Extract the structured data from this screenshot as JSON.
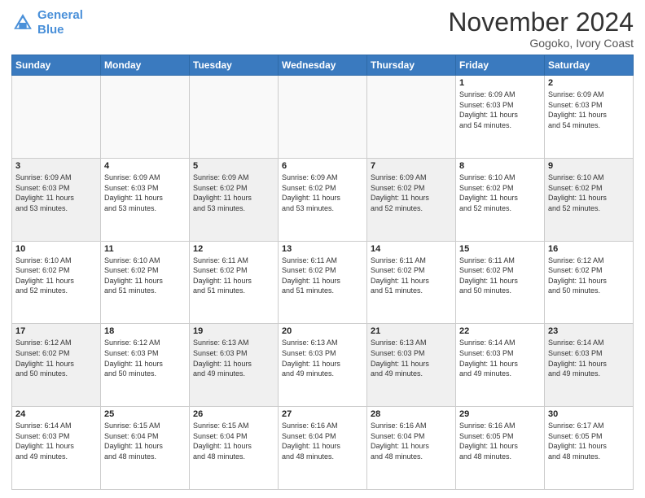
{
  "header": {
    "logo_line1": "General",
    "logo_line2": "Blue",
    "month": "November 2024",
    "location": "Gogoko, Ivory Coast"
  },
  "weekdays": [
    "Sunday",
    "Monday",
    "Tuesday",
    "Wednesday",
    "Thursday",
    "Friday",
    "Saturday"
  ],
  "weeks": [
    [
      {
        "day": "",
        "info": ""
      },
      {
        "day": "",
        "info": ""
      },
      {
        "day": "",
        "info": ""
      },
      {
        "day": "",
        "info": ""
      },
      {
        "day": "",
        "info": ""
      },
      {
        "day": "1",
        "info": "Sunrise: 6:09 AM\nSunset: 6:03 PM\nDaylight: 11 hours\nand 54 minutes."
      },
      {
        "day": "2",
        "info": "Sunrise: 6:09 AM\nSunset: 6:03 PM\nDaylight: 11 hours\nand 54 minutes."
      }
    ],
    [
      {
        "day": "3",
        "info": "Sunrise: 6:09 AM\nSunset: 6:03 PM\nDaylight: 11 hours\nand 53 minutes."
      },
      {
        "day": "4",
        "info": "Sunrise: 6:09 AM\nSunset: 6:03 PM\nDaylight: 11 hours\nand 53 minutes."
      },
      {
        "day": "5",
        "info": "Sunrise: 6:09 AM\nSunset: 6:02 PM\nDaylight: 11 hours\nand 53 minutes."
      },
      {
        "day": "6",
        "info": "Sunrise: 6:09 AM\nSunset: 6:02 PM\nDaylight: 11 hours\nand 53 minutes."
      },
      {
        "day": "7",
        "info": "Sunrise: 6:09 AM\nSunset: 6:02 PM\nDaylight: 11 hours\nand 52 minutes."
      },
      {
        "day": "8",
        "info": "Sunrise: 6:10 AM\nSunset: 6:02 PM\nDaylight: 11 hours\nand 52 minutes."
      },
      {
        "day": "9",
        "info": "Sunrise: 6:10 AM\nSunset: 6:02 PM\nDaylight: 11 hours\nand 52 minutes."
      }
    ],
    [
      {
        "day": "10",
        "info": "Sunrise: 6:10 AM\nSunset: 6:02 PM\nDaylight: 11 hours\nand 52 minutes."
      },
      {
        "day": "11",
        "info": "Sunrise: 6:10 AM\nSunset: 6:02 PM\nDaylight: 11 hours\nand 51 minutes."
      },
      {
        "day": "12",
        "info": "Sunrise: 6:11 AM\nSunset: 6:02 PM\nDaylight: 11 hours\nand 51 minutes."
      },
      {
        "day": "13",
        "info": "Sunrise: 6:11 AM\nSunset: 6:02 PM\nDaylight: 11 hours\nand 51 minutes."
      },
      {
        "day": "14",
        "info": "Sunrise: 6:11 AM\nSunset: 6:02 PM\nDaylight: 11 hours\nand 51 minutes."
      },
      {
        "day": "15",
        "info": "Sunrise: 6:11 AM\nSunset: 6:02 PM\nDaylight: 11 hours\nand 50 minutes."
      },
      {
        "day": "16",
        "info": "Sunrise: 6:12 AM\nSunset: 6:02 PM\nDaylight: 11 hours\nand 50 minutes."
      }
    ],
    [
      {
        "day": "17",
        "info": "Sunrise: 6:12 AM\nSunset: 6:02 PM\nDaylight: 11 hours\nand 50 minutes."
      },
      {
        "day": "18",
        "info": "Sunrise: 6:12 AM\nSunset: 6:03 PM\nDaylight: 11 hours\nand 50 minutes."
      },
      {
        "day": "19",
        "info": "Sunrise: 6:13 AM\nSunset: 6:03 PM\nDaylight: 11 hours\nand 49 minutes."
      },
      {
        "day": "20",
        "info": "Sunrise: 6:13 AM\nSunset: 6:03 PM\nDaylight: 11 hours\nand 49 minutes."
      },
      {
        "day": "21",
        "info": "Sunrise: 6:13 AM\nSunset: 6:03 PM\nDaylight: 11 hours\nand 49 minutes."
      },
      {
        "day": "22",
        "info": "Sunrise: 6:14 AM\nSunset: 6:03 PM\nDaylight: 11 hours\nand 49 minutes."
      },
      {
        "day": "23",
        "info": "Sunrise: 6:14 AM\nSunset: 6:03 PM\nDaylight: 11 hours\nand 49 minutes."
      }
    ],
    [
      {
        "day": "24",
        "info": "Sunrise: 6:14 AM\nSunset: 6:03 PM\nDaylight: 11 hours\nand 49 minutes."
      },
      {
        "day": "25",
        "info": "Sunrise: 6:15 AM\nSunset: 6:04 PM\nDaylight: 11 hours\nand 48 minutes."
      },
      {
        "day": "26",
        "info": "Sunrise: 6:15 AM\nSunset: 6:04 PM\nDaylight: 11 hours\nand 48 minutes."
      },
      {
        "day": "27",
        "info": "Sunrise: 6:16 AM\nSunset: 6:04 PM\nDaylight: 11 hours\nand 48 minutes."
      },
      {
        "day": "28",
        "info": "Sunrise: 6:16 AM\nSunset: 6:04 PM\nDaylight: 11 hours\nand 48 minutes."
      },
      {
        "day": "29",
        "info": "Sunrise: 6:16 AM\nSunset: 6:05 PM\nDaylight: 11 hours\nand 48 minutes."
      },
      {
        "day": "30",
        "info": "Sunrise: 6:17 AM\nSunset: 6:05 PM\nDaylight: 11 hours\nand 48 minutes."
      }
    ]
  ]
}
